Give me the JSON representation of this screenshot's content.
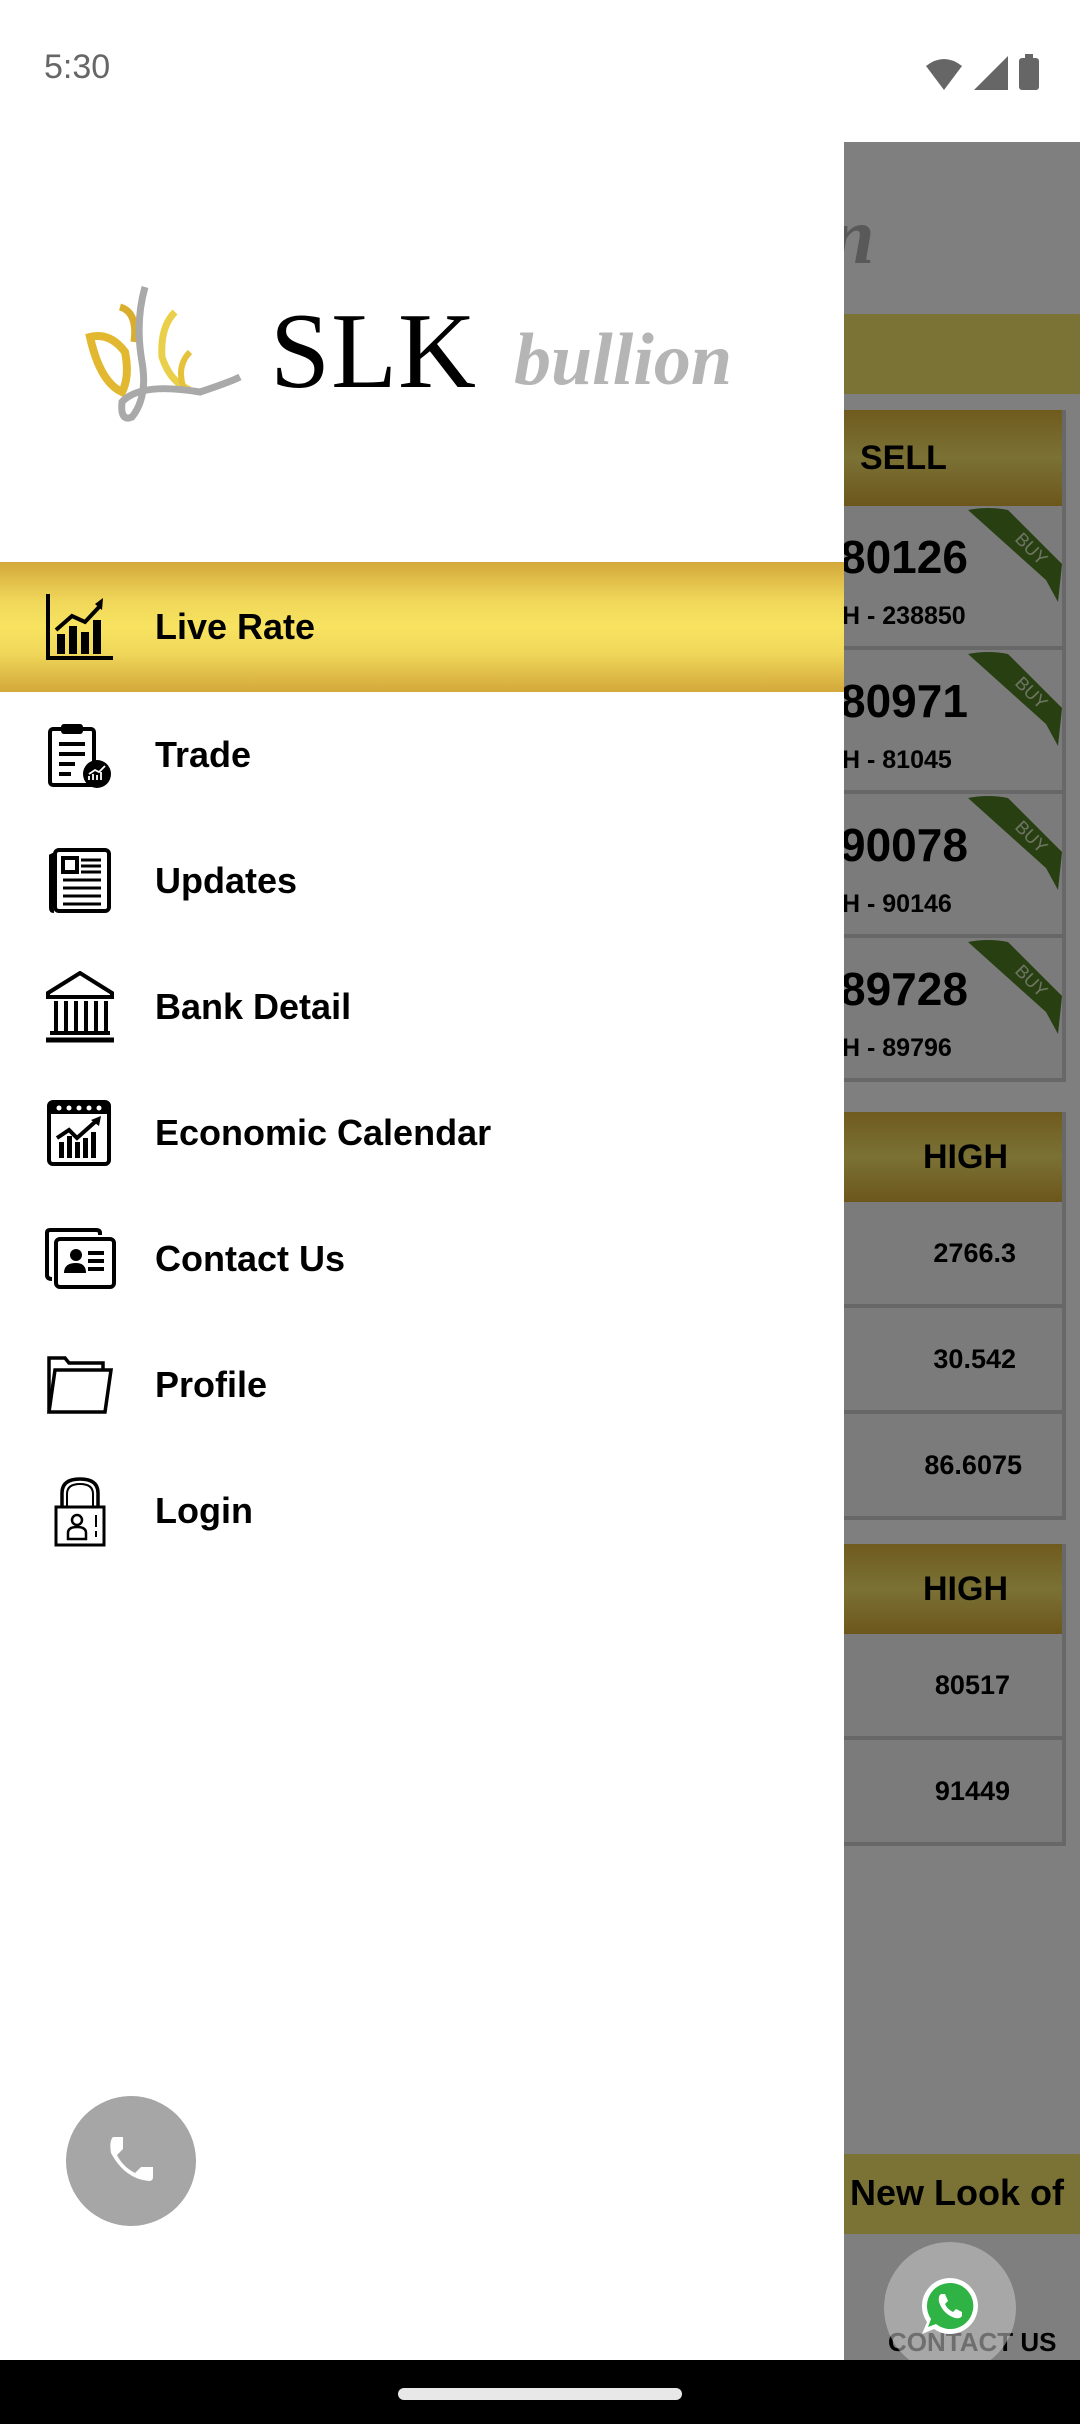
{
  "status_bar": {
    "time": "5:30",
    "icons": [
      "wifi-icon",
      "signal-icon",
      "battery-icon"
    ]
  },
  "drawer": {
    "logo": {
      "brand": "SLK",
      "suffix": "bullion"
    },
    "menu": [
      {
        "label": "Live Rate",
        "icon": "chart-growth-icon",
        "active": true
      },
      {
        "label": "Trade",
        "icon": "clipboard-chart-icon",
        "active": false
      },
      {
        "label": "Updates",
        "icon": "newspaper-icon",
        "active": false
      },
      {
        "label": "Bank Detail",
        "icon": "bank-icon",
        "active": false
      },
      {
        "label": "Economic Calendar",
        "icon": "calendar-chart-icon",
        "active": false
      },
      {
        "label": "Contact Us",
        "icon": "contact-card-icon",
        "active": false
      },
      {
        "label": "Profile",
        "icon": "folder-icon",
        "active": false
      },
      {
        "label": "Login",
        "icon": "lock-user-icon",
        "active": false
      }
    ],
    "call_button_icon": "phone-icon"
  },
  "background": {
    "logo_fragment": "n",
    "rates_table": {
      "header": "SELL",
      "rows": [
        {
          "sell": "80126",
          "high": "H - 238850",
          "badge": "BUY"
        },
        {
          "sell": "80971",
          "high": "H - 81045",
          "badge": "BUY"
        },
        {
          "sell": "90078",
          "high": "H - 90146",
          "badge": "BUY"
        },
        {
          "sell": "89728",
          "high": "H - 89796",
          "badge": "BUY"
        }
      ]
    },
    "spot_table": {
      "header": "HIGH",
      "rows": [
        "2766.3",
        "30.542",
        "86.6075"
      ]
    },
    "futures_table": {
      "header": "HIGH",
      "rows": [
        "80517",
        "91449"
      ]
    },
    "marquee_text": "e New  Look of",
    "contact_label": "CONTACT US",
    "whatsapp_icon": "whatsapp-icon"
  },
  "colors": {
    "gold_light": "#f8e360",
    "gold_dark": "#d3a83a",
    "ribbon_green": "#4a7a1f",
    "fab_gray": "#a6a6a6",
    "scrim": "rgba(0,0,0,0.5)"
  }
}
